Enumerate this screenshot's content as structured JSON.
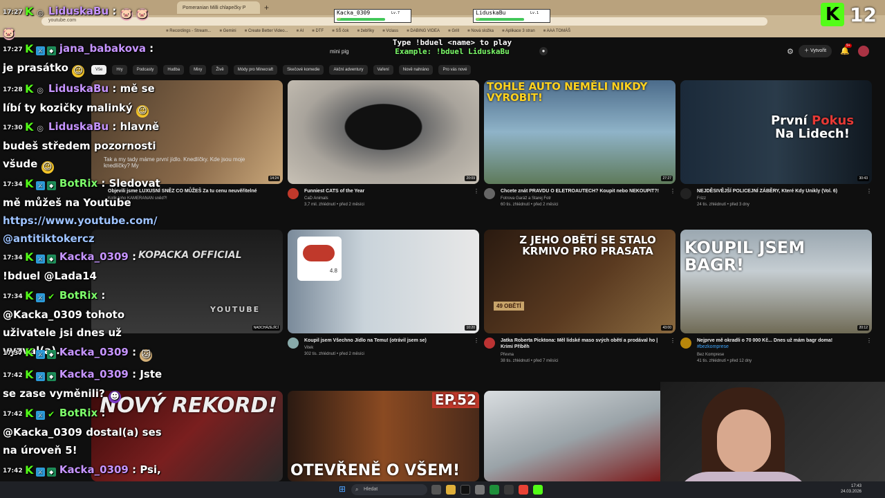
{
  "browser": {
    "active_tab_title": "Pomeranian Milli chlapečky P",
    "address": "youtube.com",
    "bookmarks": [
      "Recordings - Stream...",
      "Gemini",
      "Create Better Video...",
      "AI",
      "DTF",
      "SŠ čok",
      "žebříky",
      "Vclass",
      "DABING VIDEA",
      "Grill",
      "Nová složka",
      "Aplikace 3 stran",
      "AAA TOMÁŠ"
    ]
  },
  "youtube": {
    "search_value": "mini pig",
    "create_label": "Vytvořit",
    "notification_count": "9+",
    "chips": [
      "Vše",
      "Hry",
      "Podcasty",
      "Hudba",
      "Mixy",
      "Živě",
      "Módy pro Minecraft",
      "Skečové komedie",
      "Akční adventury",
      "Vaření",
      "Nově nahráno",
      "Pro vás nové"
    ],
    "videos": [
      {
        "title": "Funniest CATS of the Year",
        "channel": "CaD Animals",
        "stats": "3,7 mil. zhlédnutí • před 2 měsíci",
        "duration": "20:09"
      },
      {
        "title": "Chcete znát PRAVDU O ELETROAUTECH? Koupit nebo NEKOUPIT?!",
        "channel": "Fotrova Garáž a Starej Fotr",
        "stats": "60 tis. zhlédnutí • před 2 měsíci",
        "duration": "27:27",
        "thumb_text": "TOHLE AUTO NEMĚLI NIKDY VYROBIT!"
      },
      {
        "title": "NEJDĚSIVĚJŠÍ POLICEJNÍ ZÁBĚRY, Které Kdy Unikly (Vol. 6)",
        "channel": "Frizz",
        "stats": "24 tis. zhlédnutí • před 3 dny",
        "duration": "30:43",
        "thumb_text_a": "První ",
        "thumb_text_b": "Pokus",
        "thumb_text_c": " Na Lidech!"
      },
      {
        "title": "Koupil jsem Všechno Jídlo na Temu! (otrávil jsem se)",
        "channel": "Vitek",
        "stats": "302 tis. zhlédnutí • před 2 měsíci",
        "duration": "10:20",
        "thumb_rating": "4.8"
      },
      {
        "title": "Jatka Roberta Picktona: Měl lidské maso svých obětí a prodával ho | Krimi Příběh",
        "channel": "Převna",
        "stats": "38 tis. zhlédnutí • před 7 měsíci",
        "duration": "43:00",
        "thumb_text": "Z JEHO OBĚTÍ SE STALO KRMIVO PRO PRASATA",
        "thumb_caption": "49 OBĚTÍ"
      },
      {
        "title": "Nejprve mě okradli o 70 000 Kč... Dnes už mám bagr doma!",
        "channel": "Bez Komprese",
        "stats": "41 tis. zhlédnutí • před 12 dny",
        "duration": "20:12",
        "hashtag": "#bezkomprese",
        "thumb_text": "KOUPIL JSEM BAGR!"
      },
      {
        "thumb_text": "NOVÝ REKORD!"
      },
      {
        "thumb_text": "OTEVŘENĚ O VŠEM!",
        "thumb_badge": "EP.52"
      },
      {}
    ],
    "first_row_partial": {
      "channel_line": "Objevili jsme LUXUSNÍ SNĚZ CO MŮŽEŠ Za tu cenu neuvěřitelné",
      "sub": "Kolik toho KAMERANAN sněd?!",
      "duration": "14:24",
      "caption": "Tak a my tady máme první jídlo. Knedlíčky. Kde jsou moje knedlíčky? My"
    },
    "second_row_partial": {
      "thumb_text": "KOPACKA OFFICIAL",
      "thumb_sub": "YOUTUBE",
      "thumb_badge": "NADCHÁZEJÍCÍ"
    }
  },
  "overlay": {
    "duel": {
      "player1": {
        "name": "Kacka_0309",
        "level": "Lv.7",
        "hp_label": "HP",
        "hp_fraction": 1.0
      },
      "player2": {
        "name": "LiduskaBu",
        "level": "Lv.1",
        "hp_label": "HP",
        "hp_fraction": 1.0
      },
      "hint_line1": "Type !bduel <name> to play",
      "hint_line2": "Example: !bduel LiduskaBu"
    },
    "kick_level": {
      "letter": "K",
      "number": "12"
    }
  },
  "chat": [
    {
      "time": "17:27",
      "user": "LiduskaBu",
      "text": "",
      "emotes": [
        "pig",
        "pig",
        "pig"
      ]
    },
    {
      "time": "17:27",
      "user": "jana_babakova",
      "text": "je prasátko",
      "emotes": [
        "smile"
      ]
    },
    {
      "time": "17:28",
      "user": "LiduskaBu",
      "text": "mě se líbí ty kozičky malinký",
      "emotes": [
        "grin"
      ]
    },
    {
      "time": "17:30",
      "user": "LiduskaBu",
      "text": "hlavně budeš středem pozornosti všude",
      "emotes": [
        "grin"
      ]
    },
    {
      "time": "17:34",
      "user": "BotRix",
      "text": "Sledovat mě můžeš na Youtube",
      "link": "https://www.youtube.com/@antitiktokercz"
    },
    {
      "time": "17:34",
      "user": "Kacka_0309",
      "text": "!bduel @Lada14"
    },
    {
      "time": "17:34",
      "user": "BotRix",
      "text": "@Kacka_0309 tohoto uživatele jsi dnes už vyzval(a)."
    },
    {
      "time": "17:37",
      "user": "Kacka_0309",
      "text": "",
      "emotes": [
        "cat"
      ]
    },
    {
      "time": "17:42",
      "user": "Kacka_0309",
      "text": "Jste se zase vyměnili?",
      "emotes": [
        "devil"
      ]
    },
    {
      "time": "17:42",
      "user": "BotRix",
      "text": "@Kacka_0309 dostal(a) ses na úroveň 5!"
    },
    {
      "time": "17:42",
      "user": "Kacka_0309",
      "text": "Psi, kočky"
    }
  ],
  "taskbar": {
    "search_placeholder": "Hledat",
    "time": "17:43",
    "date": "24.03.2026"
  },
  "colors": {
    "kick_green": "#53fc18",
    "chat_name": "#c694ff",
    "youtube_bg": "#0f0f0f"
  }
}
